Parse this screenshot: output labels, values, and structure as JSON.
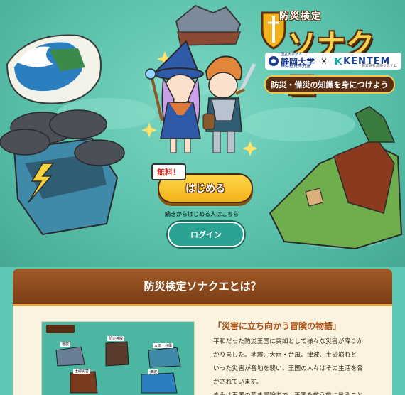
{
  "logo": {
    "subtitle": "防災検定",
    "title": "ソナクエ"
  },
  "partners": {
    "university_top": "国立大学法人",
    "university": "静岡大学",
    "university_sub": "藤井基貴研究室",
    "times": "×",
    "company": "KENTEM",
    "company_sub": "株式会社建設システム"
  },
  "tagline": "防災・備災の知識を身につけよう",
  "hero": {
    "free_badge": "無料！",
    "start_button": "はじめる",
    "continue_text": "続きからはじめる人はこちら",
    "login_button": "ログイン"
  },
  "about": {
    "title": "防災検定ソナクエとは？",
    "story_title": "「災害に立ち向かう冒険の物語」",
    "story_lines": [
      "平和だった防災王国に突如として様々な災害が降りか",
      "かりました。地震、大雨・台風、津波、土砂崩れと",
      "いった災害が各地を襲い、王国の人々はその生活を脅",
      "かされています。",
      "きみは王国の若き冒険者で、王国を救う旅に出ること"
    ],
    "thumb_labels": [
      "地震",
      "防災神殿",
      "大雨・台風",
      "土砂災害",
      "津波"
    ]
  },
  "colors": {
    "accent_gold": "#f3b219",
    "brand_brown": "#7b3d17",
    "teal": "#2aa392"
  }
}
